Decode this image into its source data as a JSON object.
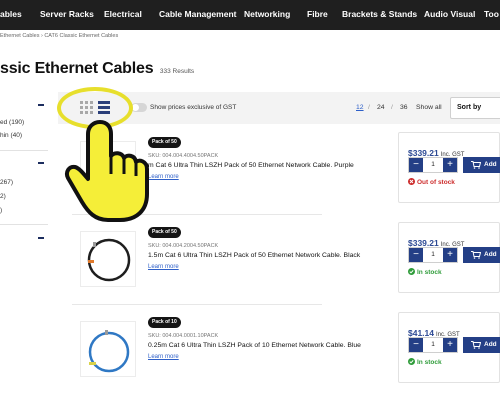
{
  "nav": {
    "items": [
      "ables",
      "Server Racks",
      "Electrical",
      "Cable Management",
      "Networking",
      "Fibre",
      "Brackets & Stands",
      "Audio Visual",
      "Too"
    ]
  },
  "breadcrumb": "Ethernet Cables  ›  CAT6 Classic Ethernet Cables",
  "page": {
    "title": "ssic Ethernet Cables",
    "result_count": "333 Results"
  },
  "sidebar": {
    "groups": [
      {
        "lines": [
          "ed (190)",
          "hin (40)"
        ]
      },
      {
        "lines": [
          "267)",
          "2)",
          ")"
        ]
      },
      {
        "lines": []
      }
    ]
  },
  "toolbar": {
    "gst_toggle_label": "Show prices exclusive of GST",
    "page_sizes": [
      "12",
      "24",
      "36",
      "Show all"
    ],
    "separator": "/",
    "active_page_size": "12",
    "sort_label": "Sort by"
  },
  "products": [
    {
      "badge": "Pack of 50",
      "sku": "SKU: 004.004.4004.50PACK",
      "name": "m Cat 6 Ultra Thin LSZH Pack of 50 Ethernet Network Cable. Purple",
      "learn_more": "Learn more",
      "price": "$339.21",
      "price_suffix": "Inc. GST",
      "qty_minus": "−",
      "qty_plus": "+",
      "qty": "1",
      "add_label": "Add",
      "stock": "Out of stock",
      "in_stock": false,
      "cable_color": "#7b4aa8"
    },
    {
      "badge": "Pack of 50",
      "sku": "SKU: 004.004.2004.50PACK",
      "name": "1.5m Cat 6 Ultra Thin LSZH Pack of 50 Ethernet Network Cable. Black",
      "learn_more": "Learn more",
      "price": "$339.21",
      "price_suffix": "Inc. GST",
      "qty_minus": "−",
      "qty_plus": "+",
      "qty": "1",
      "add_label": "Add",
      "stock": "In stock",
      "in_stock": true,
      "cable_color": "#1e1e1e"
    },
    {
      "badge": "Pack of 10",
      "sku": "SKU: 004.004.0001.10PACK",
      "name": "0.25m Cat 6 Ultra Thin LSZH Pack of 10 Ethernet Network Cable. Blue",
      "learn_more": "Learn more",
      "price": "$41.14",
      "price_suffix": "Inc. GST",
      "qty_minus": "−",
      "qty_plus": "+",
      "qty": "1",
      "add_label": "Add",
      "stock": "In stock",
      "in_stock": true,
      "cable_color": "#2f78c4"
    }
  ],
  "colors": {
    "nav_bg": "#1f1f1f",
    "accent": "#243f86",
    "price": "#2d4a94",
    "out_of_stock": "#cc2b2b",
    "in_stock": "#2f9c3a",
    "highlight": "#e7df2c"
  }
}
